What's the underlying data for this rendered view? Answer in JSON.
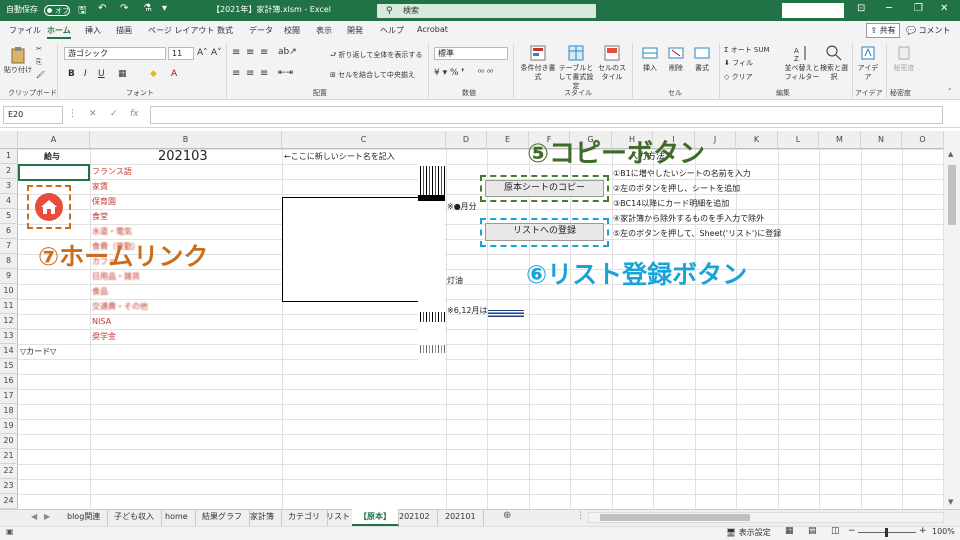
{
  "titlebar": {
    "autosave_label": "自動保存",
    "autosave_state": "オフ",
    "title": "【2021年】家計簿.xlsm  -  Excel",
    "search_placeholder": "検索"
  },
  "ribbon_tabs": [
    "ファイル",
    "ホーム",
    "挿入",
    "描画",
    "ページ レイアウト",
    "数式",
    "データ",
    "校閲",
    "表示",
    "開発",
    "ヘルプ",
    "Acrobat"
  ],
  "active_tab": "ホーム",
  "share_label": "共有",
  "comment_label": "コメント",
  "ribbon": {
    "paste": "貼り付け",
    "font_name": "游ゴシック",
    "font_size": "11",
    "wrap": "折り返して全体を表示する",
    "merge": "セルを結合して中央揃え",
    "number_format": "標準",
    "cond_format": "条件付き書式",
    "table_format": "テーブルとして書式設定",
    "cell_style": "セルのスタイル",
    "insert": "挿入",
    "delete": "削除",
    "format": "書式",
    "autosum": "オート SUM",
    "fill": "フィル",
    "clear": "クリア",
    "sort": "並べ替えとフィルター",
    "find": "検索と選択",
    "ideas": "アイデア",
    "sensitivity": "秘密度",
    "groups": [
      "クリップボード",
      "フォント",
      "配置",
      "数値",
      "スタイル",
      "セル",
      "編集",
      "アイデア",
      "秘密度"
    ]
  },
  "formula_bar": {
    "name_box": "E20",
    "formula": ""
  },
  "columns": [
    "A",
    "B",
    "C",
    "D",
    "E",
    "F",
    "G",
    "H",
    "I",
    "J",
    "K",
    "L",
    "M",
    "N",
    "O"
  ],
  "rows": [
    "1",
    "2",
    "3",
    "4",
    "5",
    "6",
    "7",
    "8",
    "9",
    "10",
    "11",
    "12",
    "13",
    "14",
    "15",
    "16",
    "17",
    "18",
    "19",
    "20",
    "21",
    "22",
    "23",
    "24"
  ],
  "cells": {
    "a1": "給与",
    "b1": "202103",
    "c1": "←ここに新しいシート名を記入",
    "b2": "フランス語",
    "b3": "家賃",
    "b4": "保育園",
    "b5": "食堂",
    "b6": "水道・電気",
    "b7": "食費（夜勤）",
    "b8": "カフェ",
    "b9": "日用品・雑貨",
    "b10": "食品",
    "b11": "交通費・その他",
    "b12": "NISA",
    "b13": "奨学金",
    "a14": "▽カード▽",
    "d4": "※●月分",
    "d9": "灯油",
    "d11": "※6,12月は"
  },
  "buttons": {
    "copy": "原本シートのコピー",
    "register": "リストへの登録"
  },
  "instructions": {
    "title": "入力方法",
    "steps": [
      "①B1に増やしたいシートの名前を入力",
      "②左のボタンを押し、シートを追加",
      "③BC14以降にカード明細を追加",
      "④家計簿から除外するものを手入力で除外",
      "⑤左のボタンを押して、Sheet('リスト')に登録"
    ]
  },
  "annotations": {
    "copy_button": "⑤コピーボタン",
    "list_button": "⑥リスト登録ボタン",
    "home_link": "⑦ホームリンク"
  },
  "colors": {
    "excel_green": "#217346",
    "annotation_green": "#3f6b2a",
    "annotation_blue": "#1aa3d6",
    "annotation_orange": "#c86e1c",
    "home_icon_red": "#e84c3d"
  },
  "sheet_tabs": [
    "blog関連",
    "子ども収入",
    "home",
    "結果グラフ",
    "家計簿",
    "カテゴリ",
    "リスト",
    "【原本】",
    "202102",
    "202101"
  ],
  "active_sheet": "【原本】",
  "status": {
    "display_settings": "表示設定",
    "zoom": "100%"
  },
  "icons": {
    "home": "home-icon",
    "add_sheet": "plus-circle-icon",
    "search": "search-icon"
  }
}
